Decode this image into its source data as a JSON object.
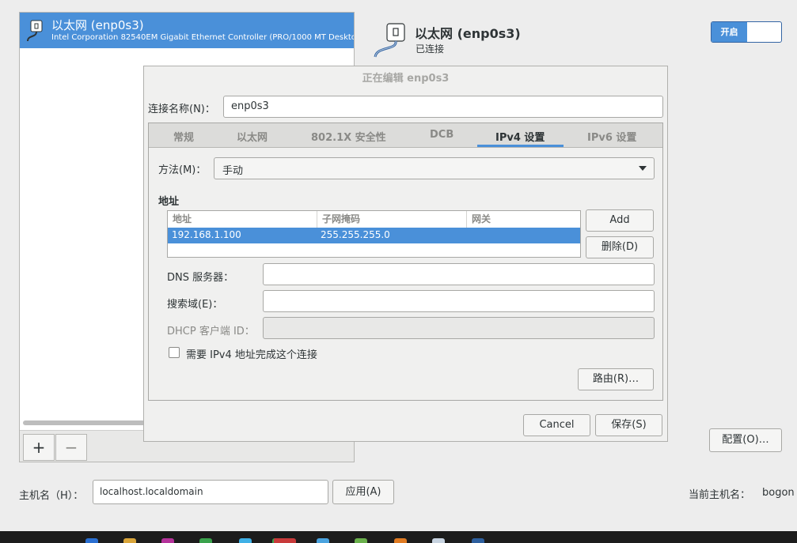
{
  "connection_list": {
    "items": [
      {
        "name": "以太网 (enp0s3)",
        "description": "Intel Corporation 82540EM Gigabit Ethernet Controller (PRO/1000 MT Deskto"
      }
    ],
    "add_label": "+",
    "remove_label": "−"
  },
  "device": {
    "name": "以太网 (enp0s3)",
    "status": "已连接",
    "toggle_on_label": "开启"
  },
  "dialog": {
    "title": "正在编辑 enp0s3",
    "conn_name_label": "连接名称(N)：",
    "conn_name_value": "enp0s3",
    "tabs": [
      {
        "label": "常规",
        "active": false
      },
      {
        "label": "以太网",
        "active": false
      },
      {
        "label": "802.1X 安全性",
        "active": false
      },
      {
        "label": "DCB",
        "active": false
      },
      {
        "label": "IPv4 设置",
        "active": true
      },
      {
        "label": "IPv6 设置",
        "active": false
      }
    ],
    "method_label": "方法(M)：",
    "method_value": "手动",
    "address_section": "地址",
    "address_columns": [
      "地址",
      "子网掩码",
      "网关"
    ],
    "address_rows": [
      {
        "address": "192.168.1.100",
        "netmask": "255.255.255.0",
        "gateway": ""
      }
    ],
    "add_button": "Add",
    "delete_button": "删除(D)",
    "dns_label": "DNS 服务器：",
    "dns_value": "",
    "search_label": "搜索域(E)：",
    "search_value": "",
    "dhcp_label": "DHCP 客户端 ID：",
    "dhcp_value": "",
    "require_ipv4_label": "需要 IPv4 地址完成这个连接",
    "routes_button": "路由(R)…",
    "cancel_button": "Cancel",
    "save_button": "保存(S)"
  },
  "config_button": "配置(O)…",
  "hostname": {
    "label": "主机名（H）：",
    "value": "localhost.localdomain",
    "apply_button": "应用(A)",
    "current_label": "当前主机名：",
    "current_value": "bogon"
  },
  "colors": {
    "accent": "#4a90d9",
    "taskbar": "#1c1c1c"
  }
}
